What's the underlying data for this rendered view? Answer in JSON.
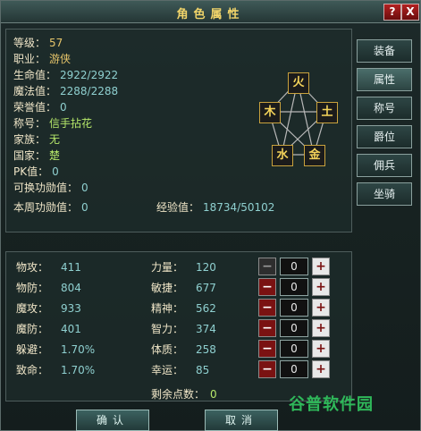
{
  "window": {
    "title": "角色属性",
    "help_label": "?",
    "close_label": "X"
  },
  "profile": {
    "level": {
      "label": "等级：",
      "value": "57"
    },
    "class": {
      "label": "职业：",
      "value": "游侠"
    },
    "hp": {
      "label": "生命值：",
      "value": "2922/2922"
    },
    "mp": {
      "label": "魔法值：",
      "value": "2288/2288"
    },
    "honor": {
      "label": "荣誉值：",
      "value": "0"
    },
    "nickname": {
      "label": "称号：",
      "value": "信手拈花"
    },
    "clan": {
      "label": "家族：",
      "value": "无"
    },
    "country": {
      "label": "国家：",
      "value": "楚"
    },
    "pk": {
      "label": "PK值：",
      "value": "0"
    },
    "exchangeable_merit": {
      "label": "可换功勋值：",
      "value": "0"
    },
    "weekly_merit": {
      "label": "本周功勋值：",
      "value": "0"
    },
    "experience": {
      "label": "经验值：",
      "value": "18734/50102"
    }
  },
  "wuxing": {
    "fire": "火",
    "wood": "木",
    "earth": "土",
    "water": "水",
    "metal": "金"
  },
  "side_tabs": [
    {
      "label": "装备"
    },
    {
      "label": "属性"
    },
    {
      "label": "称号"
    },
    {
      "label": "爵位"
    },
    {
      "label": "佣兵"
    },
    {
      "label": "坐骑"
    }
  ],
  "combat": {
    "phys_atk": {
      "label": "物攻：",
      "value": "411"
    },
    "phys_def": {
      "label": "物防：",
      "value": "804"
    },
    "mag_atk": {
      "label": "魔攻：",
      "value": "933"
    },
    "mag_def": {
      "label": "魔防：",
      "value": "401"
    },
    "dodge": {
      "label": "躲避：",
      "value": "1.70%"
    },
    "crit": {
      "label": "致命：",
      "value": "1.70%"
    }
  },
  "attributes": [
    {
      "label": "力量：",
      "value": "120",
      "alloc": "0"
    },
    {
      "label": "敏捷：",
      "value": "677",
      "alloc": "0"
    },
    {
      "label": "精神：",
      "value": "562",
      "alloc": "0"
    },
    {
      "label": "智力：",
      "value": "374",
      "alloc": "0"
    },
    {
      "label": "体质：",
      "value": "258",
      "alloc": "0"
    },
    {
      "label": "幸运：",
      "value": "85",
      "alloc": "0"
    }
  ],
  "controls": {
    "minus": "−",
    "plus": "+"
  },
  "remaining": {
    "label": "剩余点数：",
    "value": "0"
  },
  "buttons": {
    "confirm": "确认",
    "cancel": "取消"
  },
  "watermark": "谷普软件园"
}
